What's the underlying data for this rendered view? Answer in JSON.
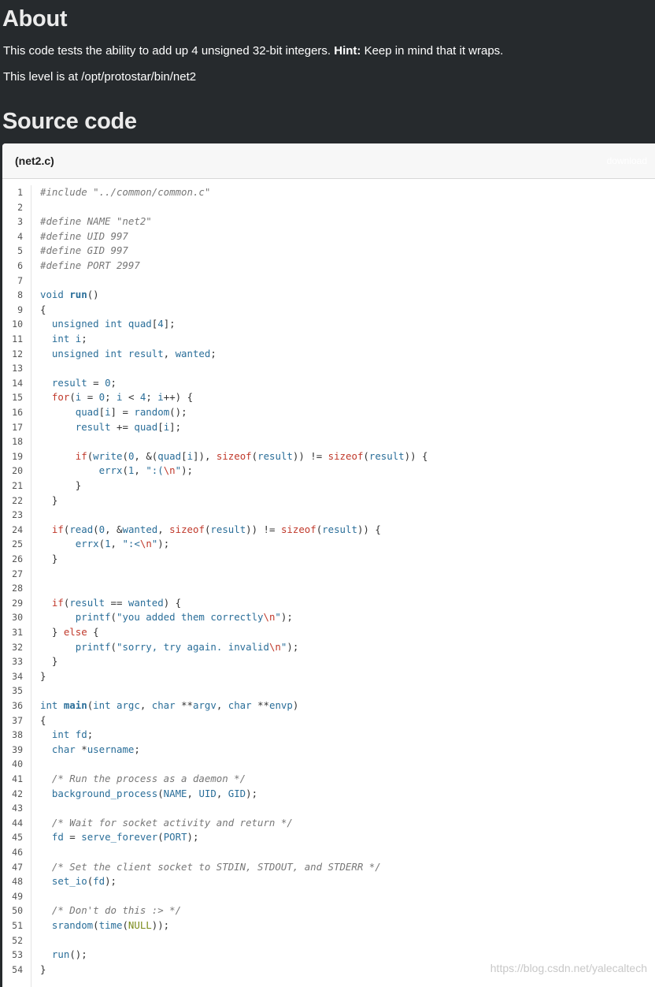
{
  "about": {
    "heading": "About",
    "p1_text": "This code tests the ability to add up 4 unsigned 32-bit integers. ",
    "p1_hint": "Hint:",
    "p1_rest": " Keep in mind that it wraps.",
    "p2": "This level is at /opt/protostar/bin/net2"
  },
  "source": {
    "heading": "Source code",
    "file_name": "(net2.c)",
    "download": "download"
  },
  "watermark": "https://blog.csdn.net/yalecaltech",
  "code_lines": [
    [
      [
        "pre",
        "#include \"../common/common.c\""
      ]
    ],
    [],
    [
      [
        "pre",
        "#define NAME \"net2\""
      ]
    ],
    [
      [
        "pre",
        "#define UID 997"
      ]
    ],
    [
      [
        "pre",
        "#define GID 997"
      ]
    ],
    [
      [
        "pre",
        "#define PORT 2997"
      ]
    ],
    [],
    [
      [
        "kw",
        "void "
      ],
      [
        "fn",
        "run"
      ],
      [
        "pl",
        "()"
      ]
    ],
    [
      [
        "pl",
        "{"
      ]
    ],
    [
      [
        "pl",
        "  "
      ],
      [
        "kw",
        "unsigned int "
      ],
      [
        "call",
        "quad"
      ],
      [
        "pl",
        "["
      ],
      [
        "num",
        "4"
      ],
      [
        "pl",
        "];"
      ]
    ],
    [
      [
        "pl",
        "  "
      ],
      [
        "kw",
        "int "
      ],
      [
        "call",
        "i"
      ],
      [
        "pl",
        ";"
      ]
    ],
    [
      [
        "pl",
        "  "
      ],
      [
        "kw",
        "unsigned int "
      ],
      [
        "call",
        "result"
      ],
      [
        "pl",
        ", "
      ],
      [
        "call",
        "wanted"
      ],
      [
        "pl",
        ";"
      ]
    ],
    [],
    [
      [
        "pl",
        "  "
      ],
      [
        "call",
        "result"
      ],
      [
        "pl",
        " = "
      ],
      [
        "num",
        "0"
      ],
      [
        "pl",
        ";"
      ]
    ],
    [
      [
        "pl",
        "  "
      ],
      [
        "red",
        "for"
      ],
      [
        "pl",
        "("
      ],
      [
        "call",
        "i"
      ],
      [
        "pl",
        " = "
      ],
      [
        "num",
        "0"
      ],
      [
        "pl",
        "; "
      ],
      [
        "call",
        "i"
      ],
      [
        "pl",
        " < "
      ],
      [
        "num",
        "4"
      ],
      [
        "pl",
        "; "
      ],
      [
        "call",
        "i"
      ],
      [
        "pl",
        "++) {"
      ]
    ],
    [
      [
        "pl",
        "      "
      ],
      [
        "call",
        "quad"
      ],
      [
        "pl",
        "["
      ],
      [
        "call",
        "i"
      ],
      [
        "pl",
        "] = "
      ],
      [
        "call",
        "random"
      ],
      [
        "pl",
        "();"
      ]
    ],
    [
      [
        "pl",
        "      "
      ],
      [
        "call",
        "result"
      ],
      [
        "pl",
        " += "
      ],
      [
        "call",
        "quad"
      ],
      [
        "pl",
        "["
      ],
      [
        "call",
        "i"
      ],
      [
        "pl",
        "];"
      ]
    ],
    [],
    [
      [
        "pl",
        "      "
      ],
      [
        "red",
        "if"
      ],
      [
        "pl",
        "("
      ],
      [
        "call",
        "write"
      ],
      [
        "pl",
        "("
      ],
      [
        "num",
        "0"
      ],
      [
        "pl",
        ", &("
      ],
      [
        "call",
        "quad"
      ],
      [
        "pl",
        "["
      ],
      [
        "call",
        "i"
      ],
      [
        "pl",
        "]), "
      ],
      [
        "red",
        "sizeof"
      ],
      [
        "pl",
        "("
      ],
      [
        "call",
        "result"
      ],
      [
        "pl",
        ")) != "
      ],
      [
        "red",
        "sizeof"
      ],
      [
        "pl",
        "("
      ],
      [
        "call",
        "result"
      ],
      [
        "pl",
        ")) {"
      ]
    ],
    [
      [
        "pl",
        "          "
      ],
      [
        "call",
        "errx"
      ],
      [
        "pl",
        "("
      ],
      [
        "num",
        "1"
      ],
      [
        "pl",
        ", "
      ],
      [
        "str",
        "\":("
      ],
      [
        "esc",
        "\\n"
      ],
      [
        "str",
        "\""
      ],
      [
        "pl",
        ");"
      ]
    ],
    [
      [
        "pl",
        "      }"
      ]
    ],
    [
      [
        "pl",
        "  }"
      ]
    ],
    [],
    [
      [
        "pl",
        "  "
      ],
      [
        "red",
        "if"
      ],
      [
        "pl",
        "("
      ],
      [
        "call",
        "read"
      ],
      [
        "pl",
        "("
      ],
      [
        "num",
        "0"
      ],
      [
        "pl",
        ", &"
      ],
      [
        "call",
        "wanted"
      ],
      [
        "pl",
        ", "
      ],
      [
        "red",
        "sizeof"
      ],
      [
        "pl",
        "("
      ],
      [
        "call",
        "result"
      ],
      [
        "pl",
        ")) != "
      ],
      [
        "red",
        "sizeof"
      ],
      [
        "pl",
        "("
      ],
      [
        "call",
        "result"
      ],
      [
        "pl",
        ")) {"
      ]
    ],
    [
      [
        "pl",
        "      "
      ],
      [
        "call",
        "errx"
      ],
      [
        "pl",
        "("
      ],
      [
        "num",
        "1"
      ],
      [
        "pl",
        ", "
      ],
      [
        "str",
        "\":<"
      ],
      [
        "esc",
        "\\n"
      ],
      [
        "str",
        "\""
      ],
      [
        "pl",
        ");"
      ]
    ],
    [
      [
        "pl",
        "  }"
      ]
    ],
    [],
    [],
    [
      [
        "pl",
        "  "
      ],
      [
        "red",
        "if"
      ],
      [
        "pl",
        "("
      ],
      [
        "call",
        "result"
      ],
      [
        "pl",
        " == "
      ],
      [
        "call",
        "wanted"
      ],
      [
        "pl",
        ") {"
      ]
    ],
    [
      [
        "pl",
        "      "
      ],
      [
        "call",
        "printf"
      ],
      [
        "pl",
        "("
      ],
      [
        "str",
        "\"you added them correctly"
      ],
      [
        "esc",
        "\\n"
      ],
      [
        "str",
        "\""
      ],
      [
        "pl",
        ");"
      ]
    ],
    [
      [
        "pl",
        "  } "
      ],
      [
        "red",
        "else"
      ],
      [
        "pl",
        " {"
      ]
    ],
    [
      [
        "pl",
        "      "
      ],
      [
        "call",
        "printf"
      ],
      [
        "pl",
        "("
      ],
      [
        "str",
        "\"sorry, try again. invalid"
      ],
      [
        "esc",
        "\\n"
      ],
      [
        "str",
        "\""
      ],
      [
        "pl",
        ");"
      ]
    ],
    [
      [
        "pl",
        "  }"
      ]
    ],
    [
      [
        "pl",
        "}"
      ]
    ],
    [],
    [
      [
        "kw",
        "int "
      ],
      [
        "fn",
        "main"
      ],
      [
        "pl",
        "("
      ],
      [
        "kw",
        "int "
      ],
      [
        "call",
        "argc"
      ],
      [
        "pl",
        ", "
      ],
      [
        "kw",
        "char "
      ],
      [
        "pl",
        "**"
      ],
      [
        "call",
        "argv"
      ],
      [
        "pl",
        ", "
      ],
      [
        "kw",
        "char "
      ],
      [
        "pl",
        "**"
      ],
      [
        "call",
        "envp"
      ],
      [
        "pl",
        ")"
      ]
    ],
    [
      [
        "pl",
        "{"
      ]
    ],
    [
      [
        "pl",
        "  "
      ],
      [
        "kw",
        "int "
      ],
      [
        "call",
        "fd"
      ],
      [
        "pl",
        ";"
      ]
    ],
    [
      [
        "pl",
        "  "
      ],
      [
        "kw",
        "char "
      ],
      [
        "pl",
        "*"
      ],
      [
        "call",
        "username"
      ],
      [
        "pl",
        ";"
      ]
    ],
    [],
    [
      [
        "pl",
        "  "
      ],
      [
        "cm",
        "/* Run the process as a daemon */"
      ]
    ],
    [
      [
        "pl",
        "  "
      ],
      [
        "call",
        "background_process"
      ],
      [
        "pl",
        "("
      ],
      [
        "call",
        "NAME"
      ],
      [
        "pl",
        ", "
      ],
      [
        "call",
        "UID"
      ],
      [
        "pl",
        ", "
      ],
      [
        "call",
        "GID"
      ],
      [
        "pl",
        ");"
      ]
    ],
    [],
    [
      [
        "pl",
        "  "
      ],
      [
        "cm",
        "/* Wait for socket activity and return */"
      ]
    ],
    [
      [
        "pl",
        "  "
      ],
      [
        "call",
        "fd"
      ],
      [
        "pl",
        " = "
      ],
      [
        "call",
        "serve_forever"
      ],
      [
        "pl",
        "("
      ],
      [
        "call",
        "PORT"
      ],
      [
        "pl",
        ");"
      ]
    ],
    [],
    [
      [
        "pl",
        "  "
      ],
      [
        "cm",
        "/* Set the client socket to STDIN, STDOUT, and STDERR */"
      ]
    ],
    [
      [
        "pl",
        "  "
      ],
      [
        "call",
        "set_io"
      ],
      [
        "pl",
        "("
      ],
      [
        "call",
        "fd"
      ],
      [
        "pl",
        ");"
      ]
    ],
    [],
    [
      [
        "pl",
        "  "
      ],
      [
        "cm",
        "/* Don't do this :> */"
      ]
    ],
    [
      [
        "pl",
        "  "
      ],
      [
        "call",
        "srandom"
      ],
      [
        "pl",
        "("
      ],
      [
        "call",
        "time"
      ],
      [
        "pl",
        "("
      ],
      [
        "null",
        "NULL"
      ],
      [
        "pl",
        "));"
      ]
    ],
    [],
    [
      [
        "pl",
        "  "
      ],
      [
        "call",
        "run"
      ],
      [
        "pl",
        "();"
      ]
    ],
    [
      [
        "pl",
        "}"
      ]
    ]
  ]
}
